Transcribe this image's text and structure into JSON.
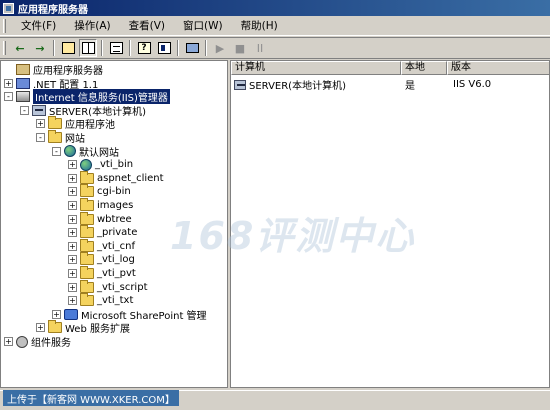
{
  "window": {
    "title": "应用程序服务器"
  },
  "menu": [
    {
      "label": "文件",
      "key": "(F)"
    },
    {
      "label": "操作",
      "key": "(A)"
    },
    {
      "label": "查看",
      "key": "(V)"
    },
    {
      "label": "窗口",
      "key": "(W)"
    },
    {
      "label": "帮助",
      "key": "(H)"
    }
  ],
  "toolbar": {
    "back": "←",
    "forward": "→",
    "play": "▶",
    "stop": "■",
    "pause": "II",
    "icons": [
      "back-icon",
      "forward-icon",
      "up-one-level-icon",
      "show-hide-tree-icon",
      "export-list-icon",
      "help-icon",
      "properties-icon",
      "computer-icon",
      "start-icon",
      "stop-icon",
      "pause-icon"
    ]
  },
  "tree": [
    {
      "label": "应用程序服务器",
      "level": 0,
      "icon": "apps",
      "expander": ""
    },
    {
      "label": ".NET 配置 1.1",
      "level": 0,
      "icon": "netcfg",
      "expander": "+"
    },
    {
      "label": "Internet 信息服务(IIS)管理器",
      "level": 0,
      "icon": "iis",
      "expander": "-",
      "selected": true
    },
    {
      "label": "SERVER(本地计算机)",
      "level": 1,
      "icon": "server",
      "expander": "-"
    },
    {
      "label": "应用程序池",
      "level": 2,
      "icon": "folder",
      "expander": "+"
    },
    {
      "label": "网站",
      "level": 2,
      "icon": "folder",
      "expander": "-"
    },
    {
      "label": "默认网站",
      "level": 3,
      "icon": "globe",
      "expander": "-"
    },
    {
      "label": "_vti_bin",
      "level": 4,
      "icon": "globe",
      "expander": "+"
    },
    {
      "label": "aspnet_client",
      "level": 4,
      "icon": "folder",
      "expander": "+"
    },
    {
      "label": "cgi-bin",
      "level": 4,
      "icon": "folder",
      "expander": "+"
    },
    {
      "label": "images",
      "level": 4,
      "icon": "folder",
      "expander": "+"
    },
    {
      "label": "wbtree",
      "level": 4,
      "icon": "folder",
      "expander": "+"
    },
    {
      "label": "_private",
      "level": 4,
      "icon": "folder",
      "expander": "+"
    },
    {
      "label": "_vti_cnf",
      "level": 4,
      "icon": "folder",
      "expander": "+"
    },
    {
      "label": "_vti_log",
      "level": 4,
      "icon": "folder",
      "expander": "+"
    },
    {
      "label": "_vti_pvt",
      "level": 4,
      "icon": "folder",
      "expander": "+"
    },
    {
      "label": "_vti_script",
      "level": 4,
      "icon": "folder",
      "expander": "+"
    },
    {
      "label": "_vti_txt",
      "level": 4,
      "icon": "folder",
      "expander": "+"
    },
    {
      "label": "Microsoft SharePoint 管理",
      "level": 3,
      "icon": "sp",
      "expander": "+"
    },
    {
      "label": "Web 服务扩展",
      "level": 2,
      "icon": "folder",
      "expander": "+"
    },
    {
      "label": "组件服务",
      "level": 0,
      "icon": "gear",
      "expander": "+"
    }
  ],
  "list": {
    "columns": [
      "计算机",
      "本地",
      "版本"
    ],
    "rows": [
      {
        "computer": "SERVER(本地计算机)",
        "local": "是",
        "version": "IIS V6.0"
      }
    ]
  },
  "watermark": "168评测中心",
  "credit": "上传于【新客网 WWW.XKER.COM】",
  "colors": {
    "title_bar": "#0a246a",
    "selection": "#0a246a",
    "face": "#d4d0c8"
  }
}
